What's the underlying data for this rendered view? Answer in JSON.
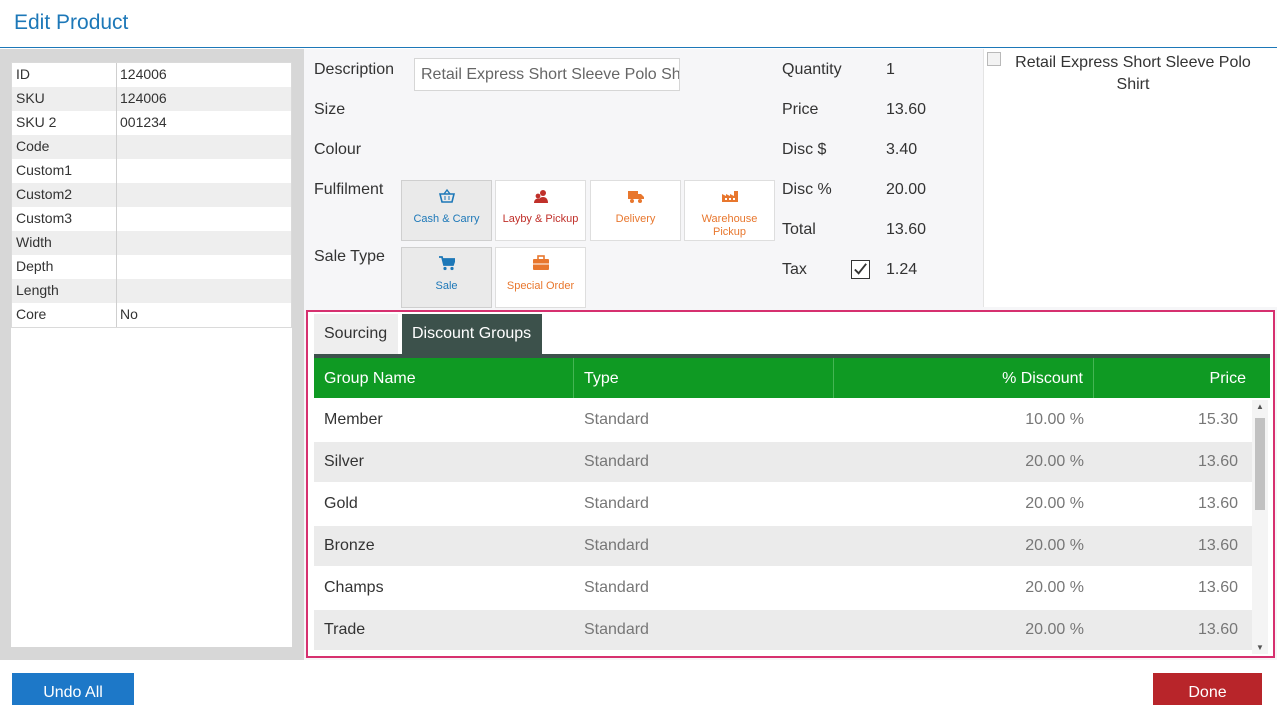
{
  "header": {
    "title": "Edit Product"
  },
  "attributes": [
    {
      "key": "ID",
      "value": "124006"
    },
    {
      "key": "SKU",
      "value": "124006"
    },
    {
      "key": "SKU 2",
      "value": "001234"
    },
    {
      "key": "Code",
      "value": ""
    },
    {
      "key": "Custom1",
      "value": ""
    },
    {
      "key": "Custom2",
      "value": ""
    },
    {
      "key": "Custom3",
      "value": ""
    },
    {
      "key": "Width",
      "value": ""
    },
    {
      "key": "Depth",
      "value": ""
    },
    {
      "key": "Length",
      "value": ""
    },
    {
      "key": "Core",
      "value": "No"
    }
  ],
  "form": {
    "description_label": "Description",
    "description_value": "Retail Express Short Sleeve Polo Shirt",
    "size_label": "Size",
    "colour_label": "Colour",
    "fulfilment_label": "Fulfilment",
    "sale_type_label": "Sale Type"
  },
  "fulfilment_options": [
    {
      "label": "Cash & Carry",
      "icon": "basket-icon",
      "color": "#1d78b8",
      "selected": true
    },
    {
      "label": "Layby & Pickup",
      "icon": "people-icon",
      "color": "#c0302a",
      "selected": false
    },
    {
      "label": "Delivery",
      "icon": "truck-icon",
      "color": "#e8772e",
      "selected": false
    },
    {
      "label": "Warehouse Pickup",
      "icon": "warehouse-icon",
      "color": "#e8772e",
      "selected": false
    }
  ],
  "sale_type_options": [
    {
      "label": "Sale",
      "icon": "cart-icon",
      "color": "#1d78b8",
      "selected": true
    },
    {
      "label": "Special Order",
      "icon": "briefcase-icon",
      "color": "#e8772e",
      "selected": false
    }
  ],
  "summary": {
    "quantity_label": "Quantity",
    "quantity": "1",
    "price_label": "Price",
    "price": "13.60",
    "disc_amount_label": "Disc $",
    "disc_amount": "3.40",
    "disc_percent_label": "Disc %",
    "disc_percent": "20.00",
    "total_label": "Total",
    "total": "13.60",
    "tax_label": "Tax",
    "tax_checked": true,
    "tax": "1.24"
  },
  "image": {
    "alt_text": "Retail Express Short Sleeve Polo Shirt"
  },
  "tabs": [
    {
      "label": "Sourcing",
      "active": false
    },
    {
      "label": "Discount Groups",
      "active": true
    }
  ],
  "grid": {
    "columns": [
      "Group Name",
      "Type",
      "% Discount",
      "Price"
    ],
    "rows": [
      {
        "name": "Member",
        "type": "Standard",
        "discount": "10.00 %",
        "price": "15.30"
      },
      {
        "name": "Silver",
        "type": "Standard",
        "discount": "20.00 %",
        "price": "13.60"
      },
      {
        "name": "Gold",
        "type": "Standard",
        "discount": "20.00 %",
        "price": "13.60"
      },
      {
        "name": "Bronze",
        "type": "Standard",
        "discount": "20.00 %",
        "price": "13.60"
      },
      {
        "name": "Champs",
        "type": "Standard",
        "discount": "20.00 %",
        "price": "13.60"
      },
      {
        "name": "Trade",
        "type": "Standard",
        "discount": "20.00 %",
        "price": "13.60"
      }
    ]
  },
  "footer": {
    "undo_label": "Undo All",
    "done_label": "Done"
  },
  "colors": {
    "accent": "#1d78b8",
    "grid_header": "#0f9a23",
    "active_tab": "#3c514b",
    "done": "#b8252a",
    "highlight_border": "#d6306f"
  }
}
